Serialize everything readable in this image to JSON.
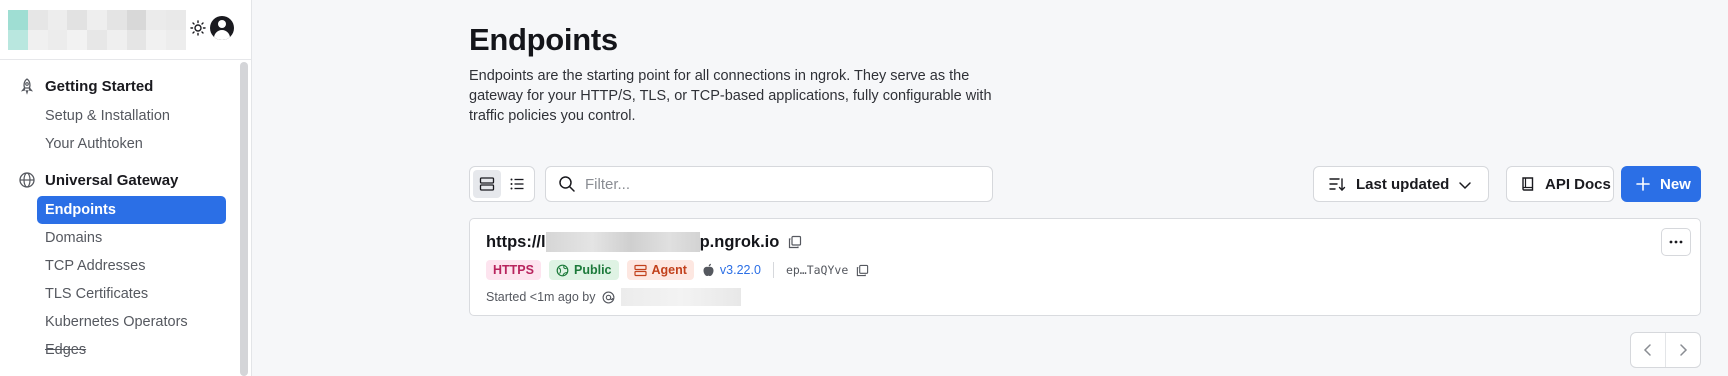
{
  "sidebar": {
    "sections": [
      {
        "label": "Getting Started",
        "icon": "rocket-icon",
        "items": [
          "Setup & Installation",
          "Your Authtoken"
        ]
      },
      {
        "label": "Universal Gateway",
        "icon": "globe-icon",
        "items": [
          "Endpoints",
          "Domains",
          "TCP Addresses",
          "TLS Certificates",
          "Kubernetes Operators",
          "Edges"
        ]
      }
    ],
    "active_item": "Endpoints",
    "struck_item": "Edges"
  },
  "page": {
    "title": "Endpoints",
    "description": "Endpoints are the starting point for all connections in ngrok. They serve as the gateway for your HTTP/S, TLS, or TCP-based applications, fully configurable with traffic policies you control."
  },
  "toolbar": {
    "filter_placeholder": "Filter...",
    "filter_value": "",
    "sort_label": "Last updated",
    "api_docs_label": "API Docs",
    "new_label": "New"
  },
  "endpoint": {
    "url_prefix": "https://l",
    "url_suffix": "p.ngrok.io",
    "tags": {
      "https": "HTTPS",
      "public": "Public",
      "agent": "Agent"
    },
    "version": "v3.22.0",
    "endpoint_id": "ep…TaQYve",
    "started": "Started <1m ago by"
  },
  "colors": {
    "accent": "#2b6fe6",
    "https_tag": "#b8245e",
    "public_tag": "#1c7a3a",
    "agent_tag": "#c2411c"
  }
}
